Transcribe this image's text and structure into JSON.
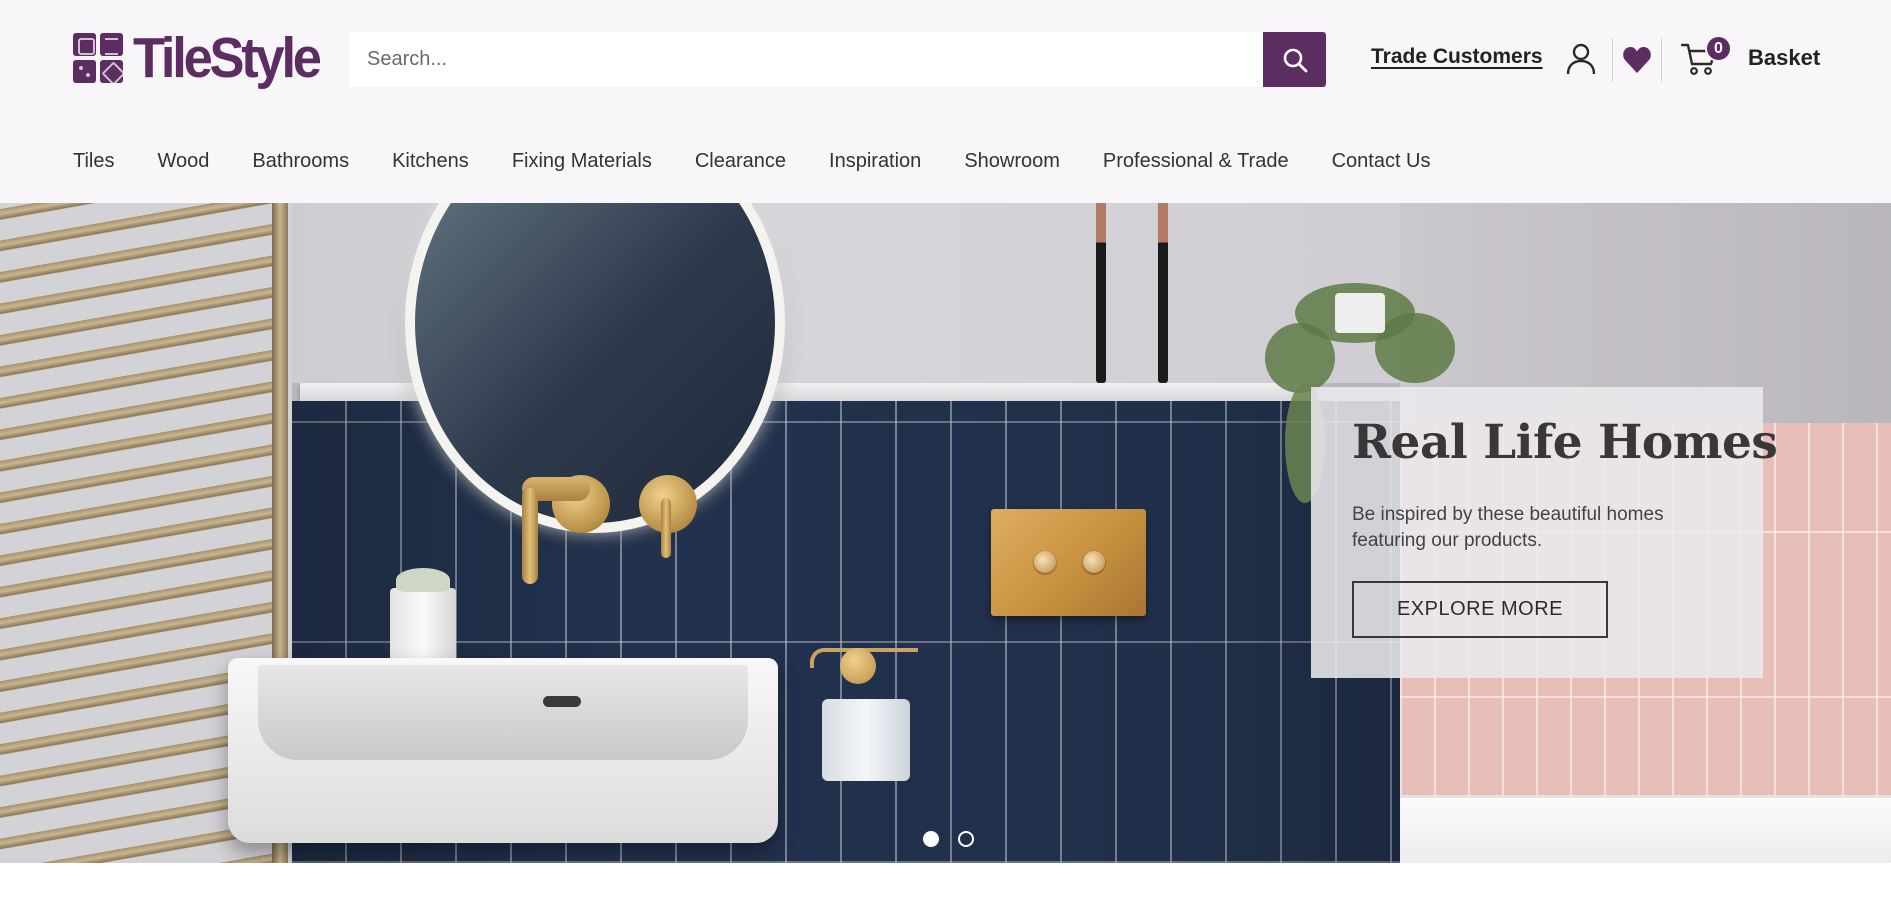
{
  "brand": {
    "name": "TileStyle",
    "color": "#5b2d61"
  },
  "search": {
    "placeholder": "Search...",
    "value": "",
    "button_icon": "search-icon"
  },
  "header_links": {
    "trade": "Trade Customers",
    "account_icon": "user-icon",
    "wishlist_icon": "heart-icon",
    "cart_icon": "cart-icon",
    "cart_count": "0",
    "basket_label": "Basket"
  },
  "nav": {
    "items": [
      {
        "label": "Tiles"
      },
      {
        "label": "Wood"
      },
      {
        "label": "Bathrooms"
      },
      {
        "label": "Kitchens"
      },
      {
        "label": "Fixing Materials"
      },
      {
        "label": "Clearance"
      },
      {
        "label": "Inspiration"
      },
      {
        "label": "Showroom"
      },
      {
        "label": "Professional & Trade"
      },
      {
        "label": "Contact Us"
      }
    ]
  },
  "hero": {
    "title": "Real Life Homes",
    "text": "Be inspired by these beautiful homes featuring our products.",
    "cta_label": "EXPLORE MORE",
    "slides_total": 2,
    "active_slide": 1
  }
}
